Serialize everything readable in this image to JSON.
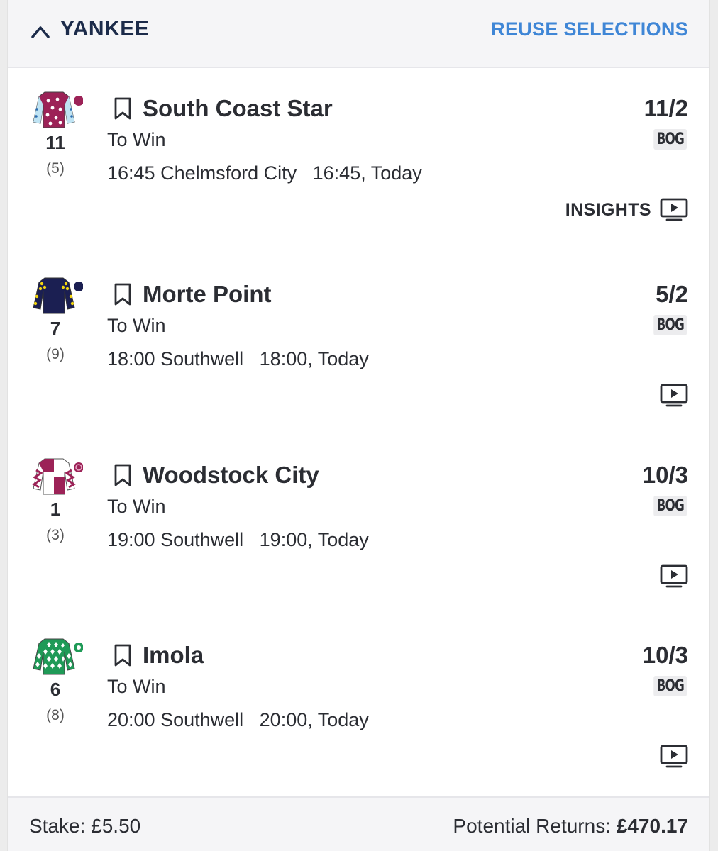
{
  "header": {
    "title": "YANKEE",
    "reuse_label": "REUSE SELECTIONS"
  },
  "selections": [
    {
      "name": "South Coast Star",
      "cloth": "11",
      "draw": "(5)",
      "market": "To Win",
      "event": "16:45 Chelmsford City",
      "time": "16:45, Today",
      "odds": "11/2",
      "bog": "BOG",
      "insights_label": "INSIGHTS",
      "silks": "maroon-white-stars-light-blue-sleeves"
    },
    {
      "name": "Morte Point",
      "cloth": "7",
      "draw": "(9)",
      "market": "To Win",
      "event": "18:00 Southwell",
      "time": "18:00, Today",
      "odds": "5/2",
      "bog": "BOG",
      "silks": "navy-yellow-epaulettes"
    },
    {
      "name": "Woodstock City",
      "cloth": "1",
      "draw": "(3)",
      "market": "To Win",
      "event": "19:00 Southwell",
      "time": "19:00, Today",
      "odds": "10/3",
      "bog": "BOG",
      "silks": "maroon-white-quartered"
    },
    {
      "name": "Imola",
      "cloth": "6",
      "draw": "(8)",
      "market": "To Win",
      "event": "20:00 Southwell",
      "time": "20:00, Today",
      "odds": "10/3",
      "bog": "BOG",
      "silks": "green-white-diamonds"
    }
  ],
  "footer": {
    "stake_label": "Stake: £5.50",
    "returns_label": "Potential Returns:",
    "returns_value": "£470.17"
  },
  "colors": {
    "accent": "#3f86d6",
    "title": "#1c2b4a",
    "text": "#2b2d33"
  },
  "icons": [
    "chevron-up-icon",
    "bookmark-icon",
    "tv-play-icon"
  ]
}
